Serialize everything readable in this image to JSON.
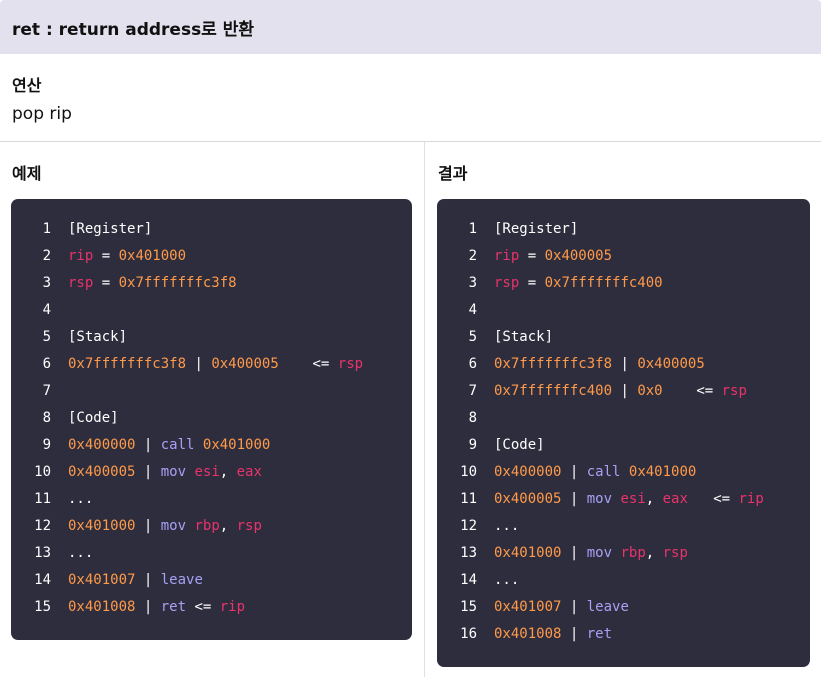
{
  "title": "ret : return address로 반환",
  "operation": {
    "heading": "연산",
    "body": "pop rip"
  },
  "example": {
    "heading": "예제",
    "lines": [
      {
        "n": "1",
        "tokens": [
          {
            "t": "[Register]",
            "c": "white"
          }
        ]
      },
      {
        "n": "2",
        "tokens": [
          {
            "t": "rip",
            "c": "pink"
          },
          {
            "t": " = ",
            "c": "white"
          },
          {
            "t": "0x401000",
            "c": "orange"
          }
        ]
      },
      {
        "n": "3",
        "tokens": [
          {
            "t": "rsp",
            "c": "pink"
          },
          {
            "t": " = ",
            "c": "white"
          },
          {
            "t": "0x7fffffffc3f8",
            "c": "orange"
          }
        ]
      },
      {
        "n": "4",
        "tokens": []
      },
      {
        "n": "5",
        "tokens": [
          {
            "t": "[Stack]",
            "c": "white"
          }
        ]
      },
      {
        "n": "6",
        "tokens": [
          {
            "t": "0x7fffffffc3f8",
            "c": "orange"
          },
          {
            "t": " | ",
            "c": "white"
          },
          {
            "t": "0x400005",
            "c": "orange"
          },
          {
            "t": "    <= ",
            "c": "white"
          },
          {
            "t": "rsp",
            "c": "pink"
          }
        ]
      },
      {
        "n": "7",
        "tokens": []
      },
      {
        "n": "8",
        "tokens": [
          {
            "t": "[Code]",
            "c": "white"
          }
        ]
      },
      {
        "n": "9",
        "tokens": [
          {
            "t": "0x400000",
            "c": "orange"
          },
          {
            "t": " | ",
            "c": "white"
          },
          {
            "t": "call",
            "c": "purple"
          },
          {
            "t": " ",
            "c": "white"
          },
          {
            "t": "0x401000",
            "c": "orange"
          }
        ]
      },
      {
        "n": "10",
        "tokens": [
          {
            "t": "0x400005",
            "c": "orange"
          },
          {
            "t": " | ",
            "c": "white"
          },
          {
            "t": "mov",
            "c": "purple"
          },
          {
            "t": " ",
            "c": "white"
          },
          {
            "t": "esi",
            "c": "pink"
          },
          {
            "t": ", ",
            "c": "white"
          },
          {
            "t": "eax",
            "c": "pink"
          }
        ]
      },
      {
        "n": "11",
        "tokens": [
          {
            "t": "...",
            "c": "white"
          }
        ]
      },
      {
        "n": "12",
        "tokens": [
          {
            "t": "0x401000",
            "c": "orange"
          },
          {
            "t": " | ",
            "c": "white"
          },
          {
            "t": "mov",
            "c": "purple"
          },
          {
            "t": " ",
            "c": "white"
          },
          {
            "t": "rbp",
            "c": "pink"
          },
          {
            "t": ", ",
            "c": "white"
          },
          {
            "t": "rsp",
            "c": "pink"
          }
        ]
      },
      {
        "n": "13",
        "tokens": [
          {
            "t": "...",
            "c": "white"
          }
        ]
      },
      {
        "n": "14",
        "tokens": [
          {
            "t": "0x401007",
            "c": "orange"
          },
          {
            "t": " | ",
            "c": "white"
          },
          {
            "t": "leave",
            "c": "purple"
          }
        ]
      },
      {
        "n": "15",
        "tokens": [
          {
            "t": "0x401008",
            "c": "orange"
          },
          {
            "t": " | ",
            "c": "white"
          },
          {
            "t": "ret",
            "c": "purple"
          },
          {
            "t": " <= ",
            "c": "white"
          },
          {
            "t": "rip",
            "c": "pink"
          }
        ]
      }
    ]
  },
  "result": {
    "heading": "결과",
    "lines": [
      {
        "n": "1",
        "tokens": [
          {
            "t": "[Register]",
            "c": "white"
          }
        ]
      },
      {
        "n": "2",
        "tokens": [
          {
            "t": "rip",
            "c": "pink"
          },
          {
            "t": " = ",
            "c": "white"
          },
          {
            "t": "0x400005",
            "c": "orange"
          }
        ]
      },
      {
        "n": "3",
        "tokens": [
          {
            "t": "rsp",
            "c": "pink"
          },
          {
            "t": " = ",
            "c": "white"
          },
          {
            "t": "0x7fffffffc400",
            "c": "orange"
          }
        ]
      },
      {
        "n": "4",
        "tokens": []
      },
      {
        "n": "5",
        "tokens": [
          {
            "t": "[Stack]",
            "c": "white"
          }
        ]
      },
      {
        "n": "6",
        "tokens": [
          {
            "t": "0x7fffffffc3f8",
            "c": "orange"
          },
          {
            "t": " | ",
            "c": "white"
          },
          {
            "t": "0x400005",
            "c": "orange"
          }
        ]
      },
      {
        "n": "7",
        "tokens": [
          {
            "t": "0x7fffffffc400",
            "c": "orange"
          },
          {
            "t": " | ",
            "c": "white"
          },
          {
            "t": "0x0",
            "c": "orange"
          },
          {
            "t": "    <= ",
            "c": "white"
          },
          {
            "t": "rsp",
            "c": "pink"
          }
        ]
      },
      {
        "n": "8",
        "tokens": []
      },
      {
        "n": "9",
        "tokens": [
          {
            "t": "[Code]",
            "c": "white"
          }
        ]
      },
      {
        "n": "10",
        "tokens": [
          {
            "t": "0x400000",
            "c": "orange"
          },
          {
            "t": " | ",
            "c": "white"
          },
          {
            "t": "call",
            "c": "purple"
          },
          {
            "t": " ",
            "c": "white"
          },
          {
            "t": "0x401000",
            "c": "orange"
          }
        ]
      },
      {
        "n": "11",
        "tokens": [
          {
            "t": "0x400005",
            "c": "orange"
          },
          {
            "t": " | ",
            "c": "white"
          },
          {
            "t": "mov",
            "c": "purple"
          },
          {
            "t": " ",
            "c": "white"
          },
          {
            "t": "esi",
            "c": "pink"
          },
          {
            "t": ", ",
            "c": "white"
          },
          {
            "t": "eax",
            "c": "pink"
          },
          {
            "t": "   <= ",
            "c": "white"
          },
          {
            "t": "rip",
            "c": "pink"
          }
        ]
      },
      {
        "n": "12",
        "tokens": [
          {
            "t": "...",
            "c": "white"
          }
        ]
      },
      {
        "n": "13",
        "tokens": [
          {
            "t": "0x401000",
            "c": "orange"
          },
          {
            "t": " | ",
            "c": "white"
          },
          {
            "t": "mov",
            "c": "purple"
          },
          {
            "t": " ",
            "c": "white"
          },
          {
            "t": "rbp",
            "c": "pink"
          },
          {
            "t": ", ",
            "c": "white"
          },
          {
            "t": "rsp",
            "c": "pink"
          }
        ]
      },
      {
        "n": "14",
        "tokens": [
          {
            "t": "...",
            "c": "white"
          }
        ]
      },
      {
        "n": "15",
        "tokens": [
          {
            "t": "0x401007",
            "c": "orange"
          },
          {
            "t": " | ",
            "c": "white"
          },
          {
            "t": "leave",
            "c": "purple"
          }
        ]
      },
      {
        "n": "16",
        "tokens": [
          {
            "t": "0x401008",
            "c": "orange"
          },
          {
            "t": " | ",
            "c": "white"
          },
          {
            "t": "ret",
            "c": "purple"
          }
        ]
      }
    ]
  },
  "colors": {
    "header_bg": "#e2e1ed",
    "code_bg": "#2e2d3d",
    "address": "#ff9a4a",
    "register": "#e8336b",
    "instruction": "#a9a0f5",
    "plain": "#ffffff"
  }
}
